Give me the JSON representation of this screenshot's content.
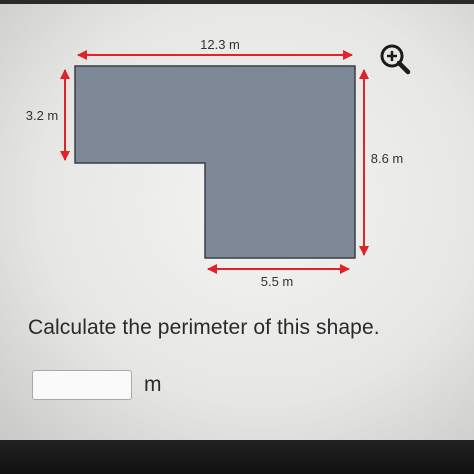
{
  "diagram": {
    "labels": {
      "top_width": "12.3 m",
      "left_height": "3.2 m",
      "right_height": "8.6 m",
      "bottom_width": "5.5 m"
    },
    "shape_fill": "#7f8896",
    "arrow_color": "#e0222a"
  },
  "zoom": {
    "icon": "zoom-in-icon"
  },
  "question": {
    "text": "Calculate the perimeter of this shape."
  },
  "answer": {
    "value": "",
    "placeholder": "",
    "unit": "m"
  }
}
